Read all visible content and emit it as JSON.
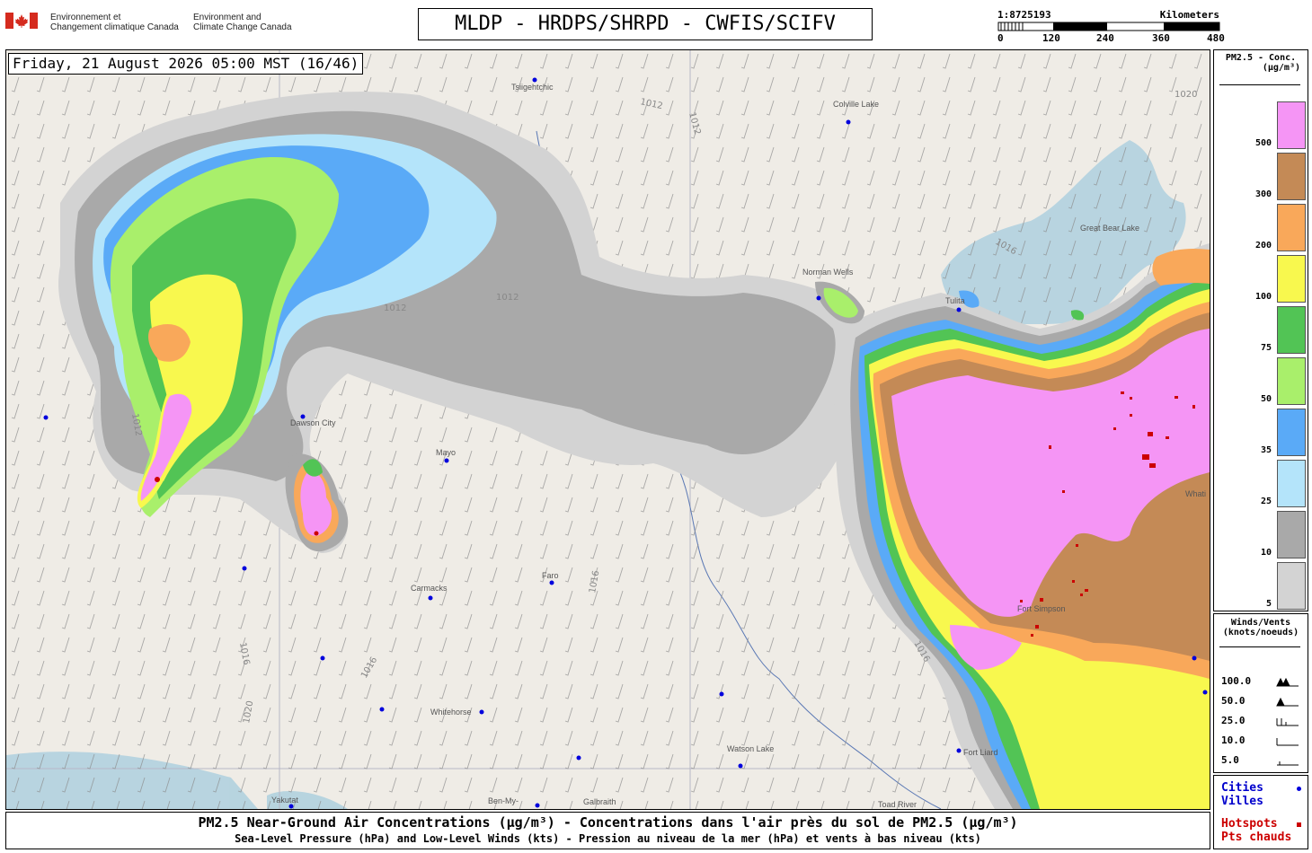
{
  "header": {
    "org_fr_line1": "Environnement et",
    "org_fr_line2": "Changement climatique Canada",
    "org_en_line1": "Environment and",
    "org_en_line2": "Climate Change Canada",
    "title": "MLDP - HRDPS/SHRPD - CWFIS/SCIFV"
  },
  "scale": {
    "ratio": "1:8725193",
    "unit": "Kilometers",
    "ticks": [
      "0",
      "120",
      "240",
      "360",
      "480"
    ]
  },
  "map": {
    "timestamp": "Friday, 21 August 2026 05:00 MST (16/46)",
    "places": [
      "Tsiigehtchic",
      "Colville Lake",
      "Great Bear Lake",
      "Norman Wells",
      "Tulita",
      "Dawson City",
      "Mayo",
      "Carmacks",
      "Faro",
      "Whitehorse",
      "Watson Lake",
      "Fort Liard",
      "Toad River",
      "Ben-My-",
      "Galbraith",
      "Yakutat",
      "Fort Simpson",
      "Whati"
    ],
    "isobars": [
      "1012",
      "1016",
      "1020"
    ],
    "colors": {
      "background": "#efece6",
      "water": "#aed0de",
      "c5": "#d3d3d3",
      "c10": "#a9a9a9",
      "c25": "#b4e4fa",
      "c35": "#5aaaf7",
      "c50": "#a9ef6b",
      "c75": "#52c455",
      "c100": "#f8f84e",
      "c200": "#f9a85a",
      "c300": "#c48a56",
      "c500": "#f595f5",
      "city": "#0000dd",
      "hotspot": "#cc0000"
    }
  },
  "legend_pm": {
    "title_line1": "PM2.5 - Conc.",
    "title_line2": "(µg/m³)",
    "levels": [
      "500",
      "300",
      "200",
      "100",
      "75",
      "50",
      "35",
      "25",
      "10",
      "5"
    ]
  },
  "legend_wind": {
    "title_line1": "Winds/Vents",
    "title_line2": "(knots/noeuds)",
    "rows": [
      "100.0",
      "50.0",
      "25.0",
      "10.0",
      "5.0"
    ]
  },
  "legend_points": {
    "cities_en": "Cities",
    "cities_fr": "Villes",
    "hotspots_en": "Hotspots",
    "hotspots_fr": "Pts chauds"
  },
  "footer": {
    "line1": "PM2.5 Near-Ground Air Concentrations (µg/m³) - Concentrations dans l'air près du sol de PM2.5 (µg/m³)",
    "line2": "Sea-Level Pressure (hPa) and Low-Level Winds (kts) - Pression au niveau de la mer (hPa) et vents à bas niveau (kts)"
  }
}
